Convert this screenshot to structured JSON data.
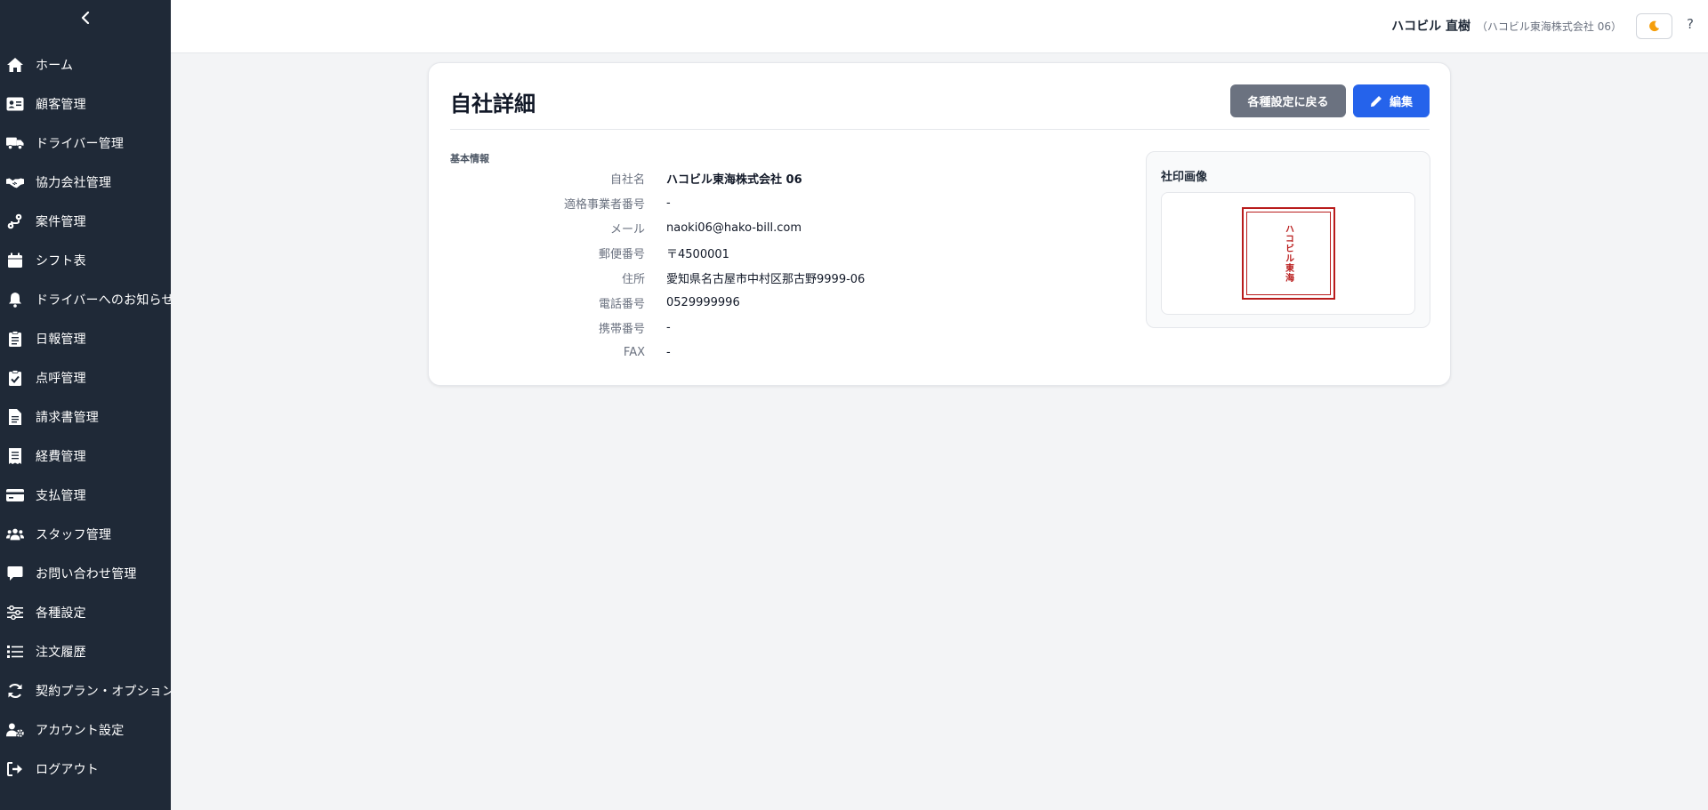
{
  "sidebar": {
    "collapse_icon": "chevron-left-icon",
    "items": [
      {
        "label": "ホーム",
        "icon": "home-icon"
      },
      {
        "label": "顧客管理",
        "icon": "id-card-icon"
      },
      {
        "label": "ドライバー管理",
        "icon": "truck-icon"
      },
      {
        "label": "協力会社管理",
        "icon": "handshake-icon"
      },
      {
        "label": "案件管理",
        "icon": "route-icon"
      },
      {
        "label": "シフト表",
        "icon": "calendar-icon"
      },
      {
        "label": "ドライバーへのお知らせ",
        "icon": "bell-icon"
      },
      {
        "label": "日報管理",
        "icon": "clipboard-list-icon"
      },
      {
        "label": "点呼管理",
        "icon": "clipboard-check-icon"
      },
      {
        "label": "請求書管理",
        "icon": "file-icon"
      },
      {
        "label": "経費管理",
        "icon": "receipt-icon"
      },
      {
        "label": "支払管理",
        "icon": "credit-card-icon"
      },
      {
        "label": "スタッフ管理",
        "icon": "users-icon"
      },
      {
        "label": "お問い合わせ管理",
        "icon": "comment-icon"
      },
      {
        "label": "各種設定",
        "icon": "sliders-icon"
      },
      {
        "label": "注文履歴",
        "icon": "list-icon"
      },
      {
        "label": "契約プラン・オプション",
        "icon": "refresh-icon"
      },
      {
        "label": "アカウント設定",
        "icon": "user-gear-icon"
      },
      {
        "label": "ログアウト",
        "icon": "logout-icon"
      }
    ]
  },
  "header": {
    "user_name": "ハコビル 直樹",
    "user_company": "（ハコビル東海株式会社 06）",
    "theme_icon": "moon-icon",
    "help_label": "?"
  },
  "main": {
    "title": "自社詳細",
    "back_button": "各種設定に戻る",
    "edit_button": "編集",
    "edit_icon": "pencil-icon",
    "section_label": "基本情報",
    "fields": [
      {
        "key": "自社名",
        "value": "ハコビル東海株式会社 06"
      },
      {
        "key": "適格事業者番号",
        "value": "-"
      },
      {
        "key": "メール",
        "value": "naoki06@hako-bill.com"
      },
      {
        "key": "郵便番号",
        "value": "〒4500001"
      },
      {
        "key": "住所",
        "value": "愛知県名古屋市中村区那古野9999-06"
      },
      {
        "key": "電話番号",
        "value": "0529999996"
      },
      {
        "key": "携帯番号",
        "value": "-"
      },
      {
        "key": "FAX",
        "value": "-"
      }
    ],
    "seal": {
      "title": "社印画像",
      "stamp_text": "ハコビル東海",
      "color": "#b91c1c"
    }
  },
  "colors": {
    "sidebar_bg": "#1f2937",
    "primary": "#2563eb",
    "secondary": "#6b7280"
  }
}
